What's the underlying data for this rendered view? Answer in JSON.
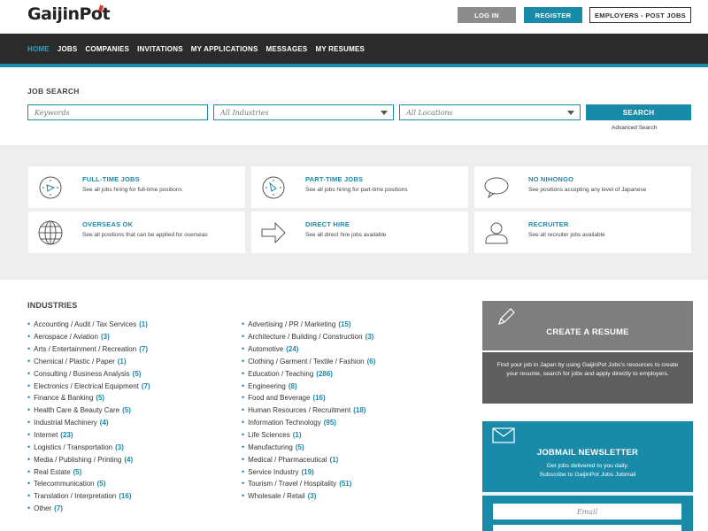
{
  "header": {
    "logo_prefix": "GaijinP",
    "logo_suffix": "t",
    "login_label": "LOG IN",
    "register_label": "REGISTER",
    "employers_label": "EMPLOYERS - POST JOBS"
  },
  "nav": {
    "items": [
      {
        "label": "HOME"
      },
      {
        "label": "JOBS"
      },
      {
        "label": "COMPANIES"
      },
      {
        "label": "INVITATIONS"
      },
      {
        "label": "MY APPLICATIONS"
      },
      {
        "label": "MESSAGES"
      },
      {
        "label": "MY RESUMES"
      }
    ]
  },
  "search": {
    "title": "JOB SEARCH",
    "keywords_placeholder": "Keywords",
    "industries_value": "All Industries",
    "locations_value": "All Locations",
    "search_label": "SEARCH",
    "advanced_label": "Advanced Search"
  },
  "categories": [
    {
      "title": "FULL-TIME JOBS",
      "desc": "See all jobs hiring for full-time positions",
      "icon": "clock-icon"
    },
    {
      "title": "PART-TIME JOBS",
      "desc": "See all jobs hiring for part-time positions",
      "icon": "clock-icon"
    },
    {
      "title": "NO NIHONGO",
      "desc": "See positions accepting any level of Japanese",
      "icon": "speech-bubble-icon"
    },
    {
      "title": "OVERSEAS OK",
      "desc": "See all positions that can be applied for overseas",
      "icon": "globe-icon"
    },
    {
      "title": "DIRECT HIRE",
      "desc": "See all direct hire jobs available",
      "icon": "arrow-right-icon"
    },
    {
      "title": "RECRUITER",
      "desc": "See all recruiter jobs available",
      "icon": "person-icon"
    }
  ],
  "industries": {
    "title": "INDUSTRIES",
    "col1": [
      {
        "label": "Accounting / Audit / Tax Services",
        "count": "(1)"
      },
      {
        "label": "Aerospace / Aviation",
        "count": "(3)"
      },
      {
        "label": "Arts / Entertainment / Recreation",
        "count": "(7)"
      },
      {
        "label": "Chemical / Plastic / Paper",
        "count": "(1)"
      },
      {
        "label": "Consulting / Business Analysis",
        "count": "(5)"
      },
      {
        "label": "Electronics / Electrical Equipment",
        "count": "(7)"
      },
      {
        "label": "Finance & Banking",
        "count": "(5)"
      },
      {
        "label": "Health Care & Beauty Care",
        "count": "(5)"
      },
      {
        "label": "Industrial Machinery",
        "count": "(4)"
      },
      {
        "label": "Internet",
        "count": "(23)"
      },
      {
        "label": "Logistics / Transportation",
        "count": "(3)"
      },
      {
        "label": "Media / Publishing / Printing",
        "count": "(4)"
      },
      {
        "label": "Real Estate",
        "count": "(5)"
      },
      {
        "label": "Telecommunication",
        "count": "(5)"
      },
      {
        "label": "Translation / Interpretation",
        "count": "(16)"
      },
      {
        "label": "Other",
        "count": "(7)"
      }
    ],
    "col2": [
      {
        "label": "Advertising / PR / Marketing",
        "count": "(15)"
      },
      {
        "label": "Architecture / Building / Construction",
        "count": "(3)"
      },
      {
        "label": "Automotive",
        "count": "(24)"
      },
      {
        "label": "Clothing / Garment / Textile / Fashion",
        "count": "(6)"
      },
      {
        "label": "Education / Teaching",
        "count": "(286)"
      },
      {
        "label": "Engineering",
        "count": "(8)"
      },
      {
        "label": "Food and Beverage",
        "count": "(16)"
      },
      {
        "label": "Human Resources / Recruitment",
        "count": "(18)"
      },
      {
        "label": "Information Technology",
        "count": "(95)"
      },
      {
        "label": "Life Sciences",
        "count": "(1)"
      },
      {
        "label": "Manufacturing",
        "count": "(5)"
      },
      {
        "label": "Medical / Pharmaceutical",
        "count": "(1)"
      },
      {
        "label": "Service Industry",
        "count": "(19)"
      },
      {
        "label": "Tourism / Travel / Hospitality",
        "count": "(51)"
      },
      {
        "label": "Wholesale / Retail",
        "count": "(3)"
      }
    ]
  },
  "resume_box": {
    "title": "CREATE A RESUME",
    "desc": "Find your job in Japan by using GaijinPot Jobs's resources to create your resume, search for jobs and apply directly to employers."
  },
  "newsletter": {
    "title": "JOBMAIL NEWSLETTER",
    "desc1": "Get jobs delivered to you daily.",
    "desc2": "Subscribe to GaijinPot Jobs Jobmail",
    "email_placeholder": "Email"
  },
  "colors": {
    "accent": "#1a8aa9",
    "nav_bg": "#2b2b2b",
    "login_bg": "#8c8c8c"
  }
}
